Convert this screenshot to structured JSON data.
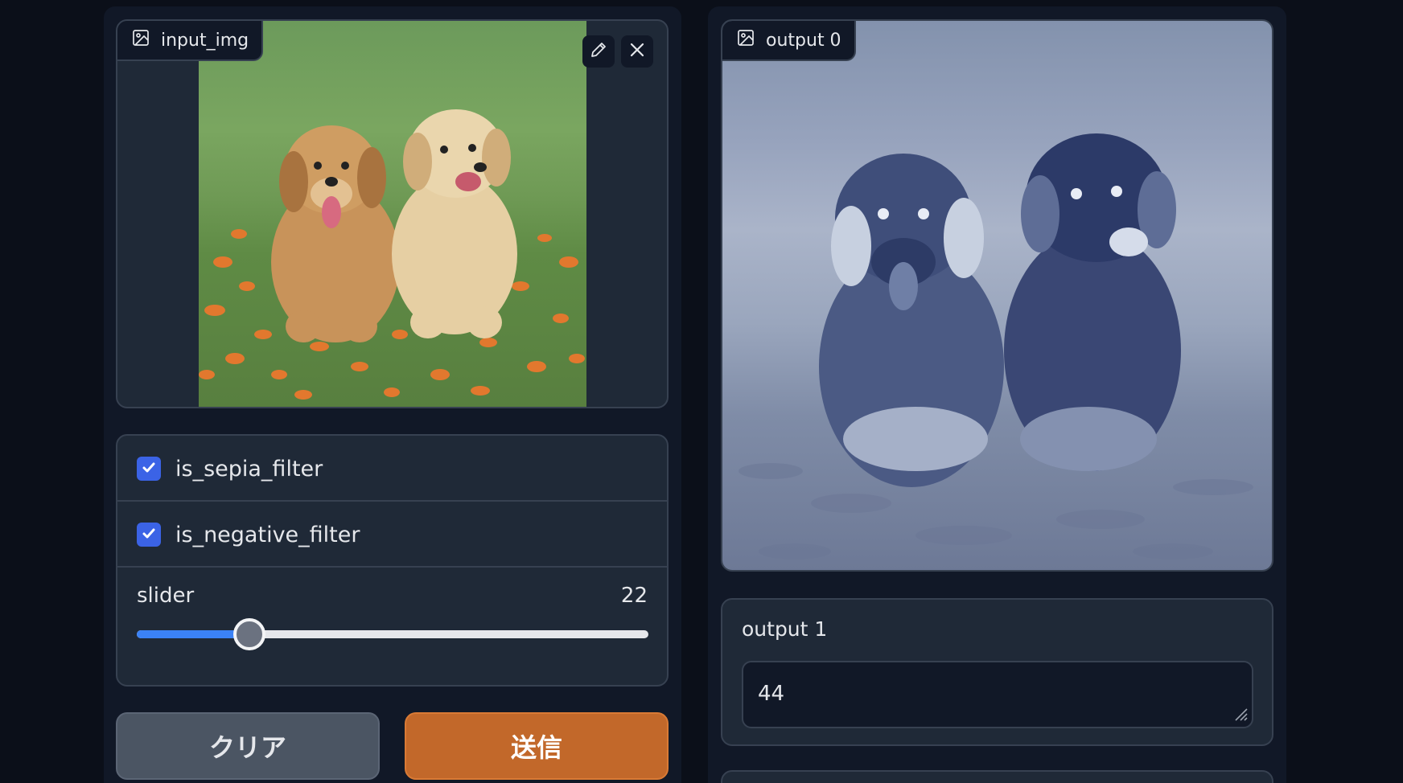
{
  "inputs": {
    "image_label": "input_img",
    "image_label_icon": "image-icon",
    "edit_icon": "pencil-icon",
    "clear_icon": "close-icon",
    "sepia": {
      "label": "is_sepia_filter",
      "checked": true
    },
    "negative": {
      "label": "is_negative_filter",
      "checked": true
    },
    "slider": {
      "label": "slider",
      "value": "22",
      "min": 0,
      "max": 100
    }
  },
  "buttons": {
    "clear_label": "クリア",
    "submit_label": "送信"
  },
  "outputs": {
    "image_label": "output 0",
    "image_label_icon": "image-icon",
    "text_label": "output 1",
    "text_value": "44"
  },
  "colors": {
    "page_bg": "#0b0f19",
    "panel_bg": "#1f2937",
    "border": "#374151",
    "accent_blue": "#3b63e6",
    "submit_orange": "#c2682a",
    "clear_gray": "#4b5563"
  }
}
